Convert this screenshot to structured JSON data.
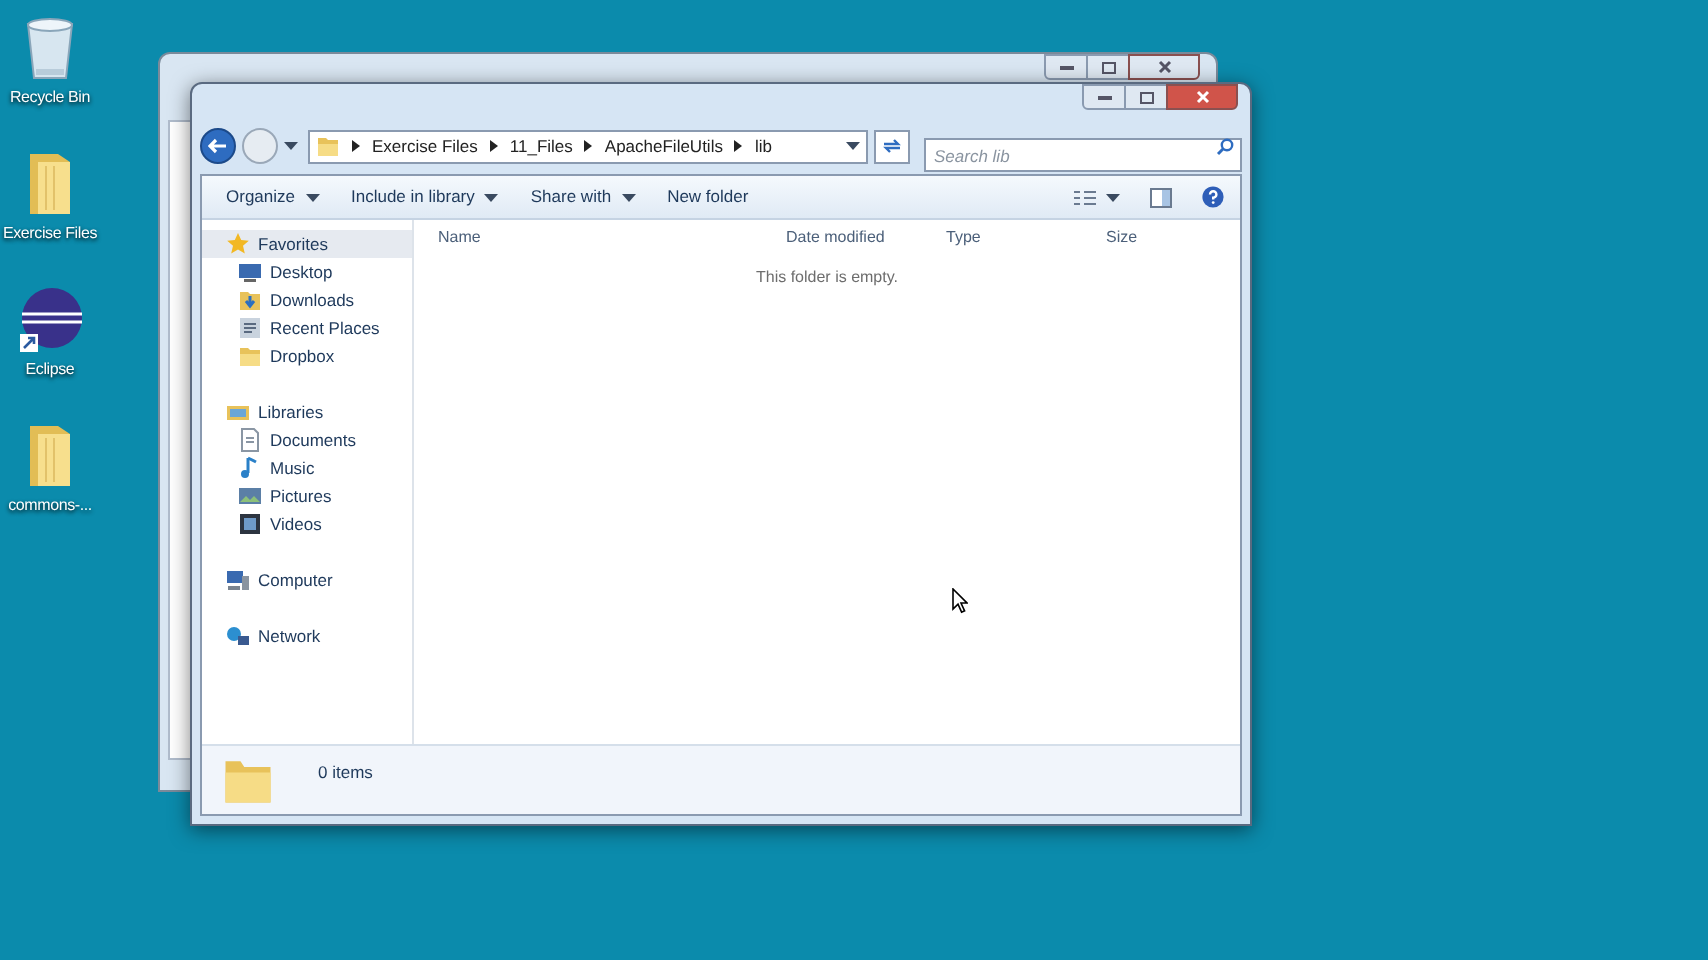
{
  "desktop_icons": [
    {
      "label": "Recycle Bin",
      "kind": "recycle-bin"
    },
    {
      "label": "Exercise Files",
      "kind": "folder"
    },
    {
      "label": "Eclipse",
      "kind": "eclipse"
    },
    {
      "label": "commons-...",
      "kind": "folder"
    }
  ],
  "explorer": {
    "breadcrumb": [
      "Exercise Files",
      "11_Files",
      "ApacheFileUtils",
      "lib"
    ],
    "search": {
      "placeholder": "Search lib"
    },
    "toolbar": [
      {
        "label": "Organize",
        "dropdown": true
      },
      {
        "label": "Include in library",
        "dropdown": true
      },
      {
        "label": "Share with",
        "dropdown": true
      },
      {
        "label": "New folder",
        "dropdown": false
      }
    ],
    "nav": [
      {
        "label": "Favorites",
        "kind": "star",
        "selected": true,
        "children": [
          {
            "label": "Desktop",
            "kind": "desktop",
            "selected": false
          },
          {
            "label": "Downloads",
            "kind": "downloads",
            "selected": false
          },
          {
            "label": "Recent Places",
            "kind": "recent",
            "selected": false
          },
          {
            "label": "Dropbox",
            "kind": "folder",
            "selected": false
          }
        ]
      },
      {
        "label": "Libraries",
        "kind": "libraries",
        "selected": false,
        "children": [
          {
            "label": "Documents",
            "kind": "document",
            "selected": false
          },
          {
            "label": "Music",
            "kind": "music",
            "selected": false
          },
          {
            "label": "Pictures",
            "kind": "pictures",
            "selected": false
          },
          {
            "label": "Videos",
            "kind": "video",
            "selected": false
          }
        ]
      },
      {
        "label": "Computer",
        "kind": "computer",
        "selected": false
      },
      {
        "label": "Network",
        "kind": "network",
        "selected": false
      }
    ],
    "columns": [
      "Name",
      "Date modified",
      "Type",
      "Size"
    ],
    "empty_message": "This folder is empty.",
    "status": "0 items"
  }
}
